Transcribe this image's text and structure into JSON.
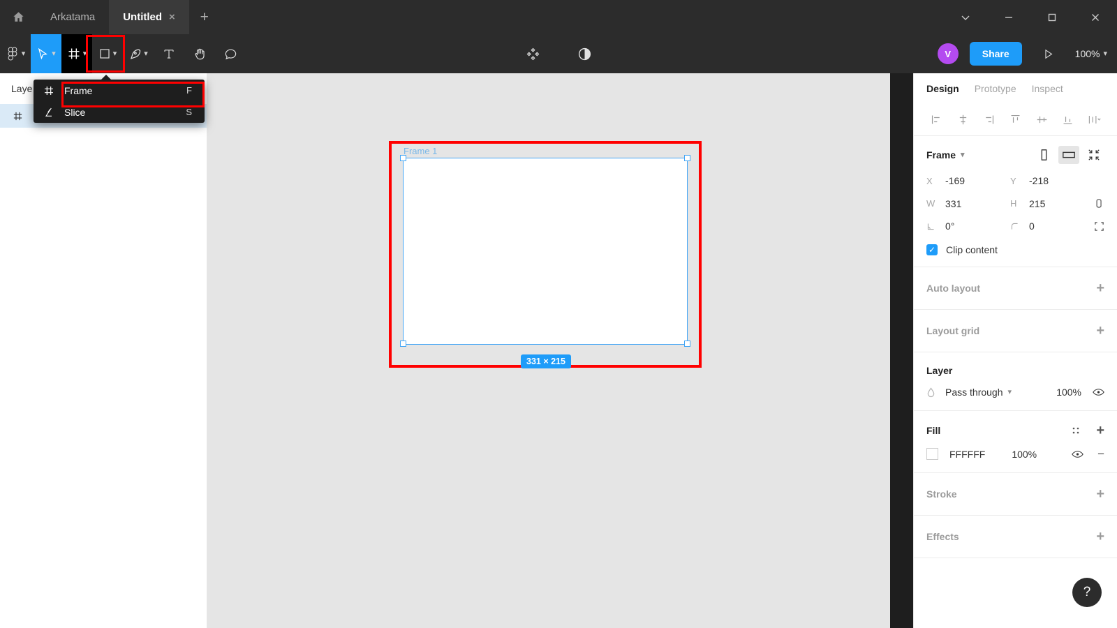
{
  "titlebar": {
    "home_icon": "home-icon",
    "tabs": [
      {
        "label": "Arkatama",
        "active": false
      },
      {
        "label": "Untitled",
        "active": true
      }
    ],
    "close_glyph": "×",
    "add_glyph": "+",
    "window_controls": [
      "chevron-down",
      "minimize",
      "maximize",
      "close"
    ]
  },
  "toolbar": {
    "menu_label": "figma-menu",
    "move_tool": "move-tool",
    "frame_tool": "frame-tool",
    "shape_tool": "shape-tool",
    "pen_tool": "pen-tool",
    "text_tool": "T",
    "hand_tool": "hand-tool",
    "comment_tool": "comment-tool",
    "components_icon": "components-icon",
    "contrast_icon": "contrast-icon",
    "avatar_initial": "V",
    "share_label": "Share",
    "present_icon": "present-icon",
    "zoom_level": "100%"
  },
  "tool_menu": {
    "items": [
      {
        "label": "Frame",
        "shortcut": "F",
        "icon": "frame-icon",
        "highlighted": true
      },
      {
        "label": "Slice",
        "shortcut": "S",
        "icon": "slice-icon",
        "highlighted": false
      }
    ]
  },
  "left_panel": {
    "tab_label": "Laye",
    "layer": {
      "name": "",
      "icon": "frame-icon"
    }
  },
  "canvas": {
    "frame_label": "Frame 1",
    "dimension_badge": "331 × 215",
    "selection_color": "#1e9cf9",
    "highlight_color": "#ff0000",
    "background": "#e5e5e5"
  },
  "right_panel": {
    "tabs": [
      {
        "label": "Design",
        "active": true
      },
      {
        "label": "Prototype",
        "active": false
      },
      {
        "label": "Inspect",
        "active": false
      }
    ],
    "align_buttons": [
      "align-left",
      "align-horizontal-center",
      "align-right",
      "align-top",
      "align-vertical-center",
      "align-bottom",
      "distribute-more"
    ],
    "frame_section": {
      "title": "Frame",
      "orientation": {
        "portrait": "portrait-icon",
        "landscape": "landscape-icon",
        "selected": "landscape"
      },
      "resize_icon": "resize-to-fit-icon",
      "x_key": "X",
      "x_value": "-169",
      "y_key": "Y",
      "y_value": "-218",
      "w_key": "W",
      "w_value": "331",
      "h_key": "H",
      "h_value": "215",
      "rotation_value": "0°",
      "corner_radius_value": "0",
      "clip_content_label": "Clip content",
      "clip_content_checked": true
    },
    "auto_layout": {
      "label": "Auto layout",
      "add": "+"
    },
    "layout_grid": {
      "label": "Layout grid",
      "add": "+"
    },
    "layer": {
      "title": "Layer",
      "blend_mode": "Pass through",
      "opacity": "100%",
      "visible_icon": "eye-icon"
    },
    "fill": {
      "title": "Fill",
      "styles_icon": "styles-icon",
      "add": "+",
      "color_hex": "FFFFFF",
      "opacity": "100%",
      "visible_icon": "eye-icon",
      "remove": "−"
    },
    "stroke": {
      "label": "Stroke",
      "add": "+"
    },
    "effects": {
      "label": "Effects",
      "add": "+"
    },
    "help_label": "?"
  },
  "colors": {
    "accent": "#1e9cf9",
    "highlight": "#ff0000",
    "avatar": "#b44bf0",
    "chrome_dark": "#2c2c2c"
  }
}
